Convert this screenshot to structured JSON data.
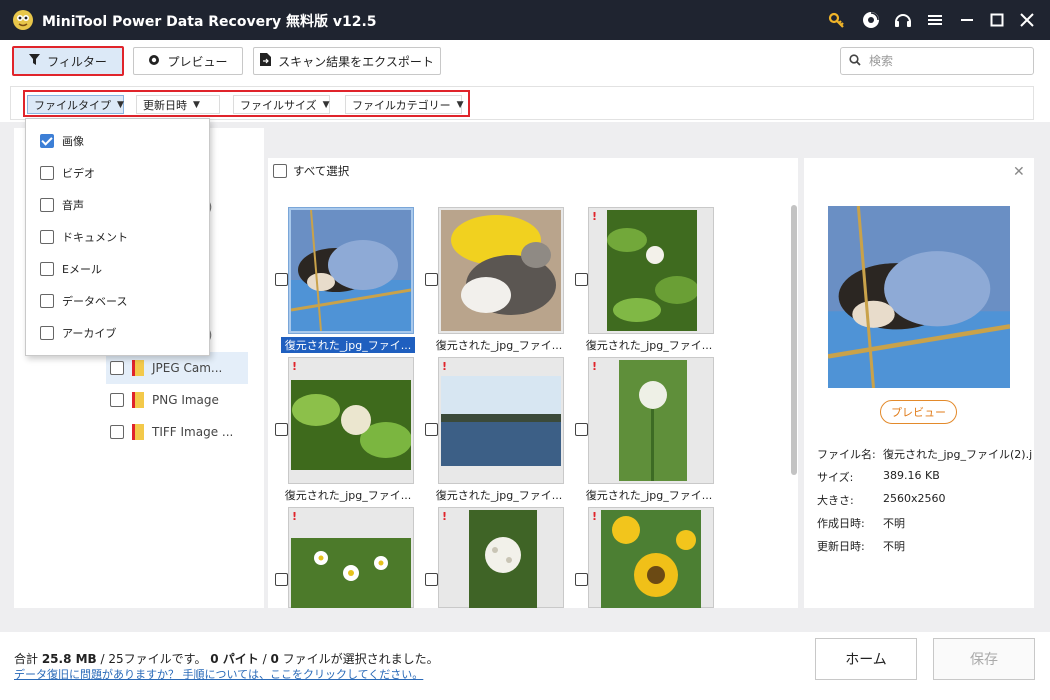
{
  "titlebar": {
    "title": "MiniTool Power Data Recovery 無料版 v12.5",
    "icons": [
      "key-icon",
      "disc-icon",
      "headset-icon",
      "menu-icon",
      "minimize-icon",
      "maximize-icon",
      "close-icon"
    ]
  },
  "toolbar": {
    "filter_label": "フィルター",
    "preview_label": "プレビュー",
    "export_label": "スキャン結果をエクスポート",
    "search_placeholder": "検索"
  },
  "filterbar": {
    "file_type": "ファイルタイプ",
    "modified": "更新日時",
    "file_size": "ファイルサイズ",
    "file_category": "ファイルカテゴリー"
  },
  "dropdown": {
    "items": [
      {
        "label": "画像",
        "checked": true
      },
      {
        "label": "ビデオ",
        "checked": false
      },
      {
        "label": "音声",
        "checked": false
      },
      {
        "label": "ドキュメント",
        "checked": false
      },
      {
        "label": "Eメール",
        "checked": false
      },
      {
        "label": "データベース",
        "checked": false
      },
      {
        "label": "アーカイブ",
        "checked": false
      }
    ]
  },
  "tree": {
    "fragments": [
      "5)",
      "3)"
    ],
    "items": [
      "JPEG Cam...",
      "PNG Image",
      "TIFF Image ..."
    ]
  },
  "grid": {
    "select_all": "すべて選択",
    "captions": [
      "復元された_jpg_ファイ...",
      "復元された_jpg_ファイ...",
      "復元された_jpg_ファイ...",
      "復元された_jpg_ファイ...",
      "復元された_jpg_ファイ...",
      "復元された_jpg_ファイ..."
    ]
  },
  "preview": {
    "button": "プレビュー",
    "meta": [
      {
        "label": "ファイル名:",
        "value": "復元された_jpg_ファイル(2).j"
      },
      {
        "label": "サイズ:",
        "value": "389.16 KB"
      },
      {
        "label": "大きさ:",
        "value": "2560x2560"
      },
      {
        "label": "作成日時:",
        "value": "不明"
      },
      {
        "label": "更新日時:",
        "value": "不明"
      }
    ]
  },
  "footer": {
    "summary_prefix": "合計 ",
    "total_size": "25.8 MB",
    "slash_count": " / 25",
    "summary_mid": "ファイルです。 ",
    "selected_bytes": "0 パイト",
    "slash2": " / ",
    "selected_files": "0",
    "summary_end": " ファイルが選択されました。",
    "help_link": "データ復旧に問題がありますか？ 手順については、ここをクリックしてください。",
    "home_button": "ホーム",
    "save_button": "保存"
  },
  "colors": {
    "titlebar": "#1f2430",
    "highlight": "#e0242b",
    "accent": "#3d7fd6",
    "preview_btn": "#e07b19"
  }
}
